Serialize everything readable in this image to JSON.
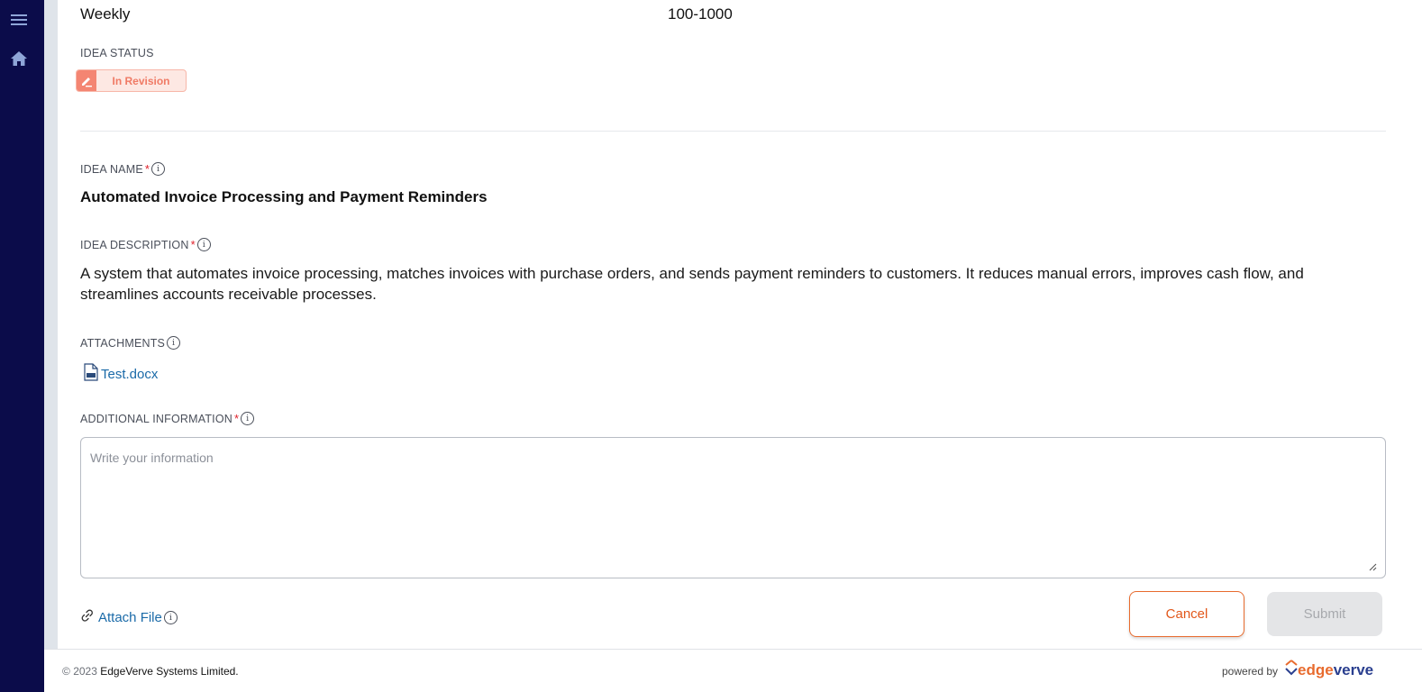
{
  "sidebar": {
    "menu_icon": "hamburger-menu-icon",
    "home_icon": "home-icon"
  },
  "details": {
    "frequency": "Weekly",
    "volume": "100-1000"
  },
  "status": {
    "label": "IDEA STATUS",
    "value": "In Revision",
    "icon": "edit-pen-icon",
    "color": "#f48572"
  },
  "idea_name": {
    "label": "IDEA NAME",
    "value": "Automated Invoice Processing and Payment Reminders"
  },
  "idea_description": {
    "label": "IDEA DESCRIPTION",
    "value": "A system that automates invoice processing, matches invoices with purchase orders, and sends payment reminders to customers. It reduces manual errors, improves cash flow, and streamlines accounts receivable processes."
  },
  "attachments": {
    "label": "ATTACHMENTS",
    "files": [
      {
        "name": "Test.docx",
        "icon": "document-file-icon"
      }
    ]
  },
  "additional_info": {
    "label": "ADDITIONAL INFORMATION",
    "value": "",
    "placeholder": "Write your information"
  },
  "actions": {
    "attach_file": "Attach File",
    "cancel": "Cancel",
    "submit": "Submit",
    "accent": "#e86b2e",
    "link_color": "#1a6aa8"
  },
  "footer": {
    "copyright_symbol": "©",
    "copyright_year": "2023",
    "company": "EdgeVerve Systems Limited.",
    "powered_by": "powered by",
    "brand_edge": "edge",
    "brand_verve": "verve"
  },
  "required_mark": "*",
  "info_glyph": "i"
}
